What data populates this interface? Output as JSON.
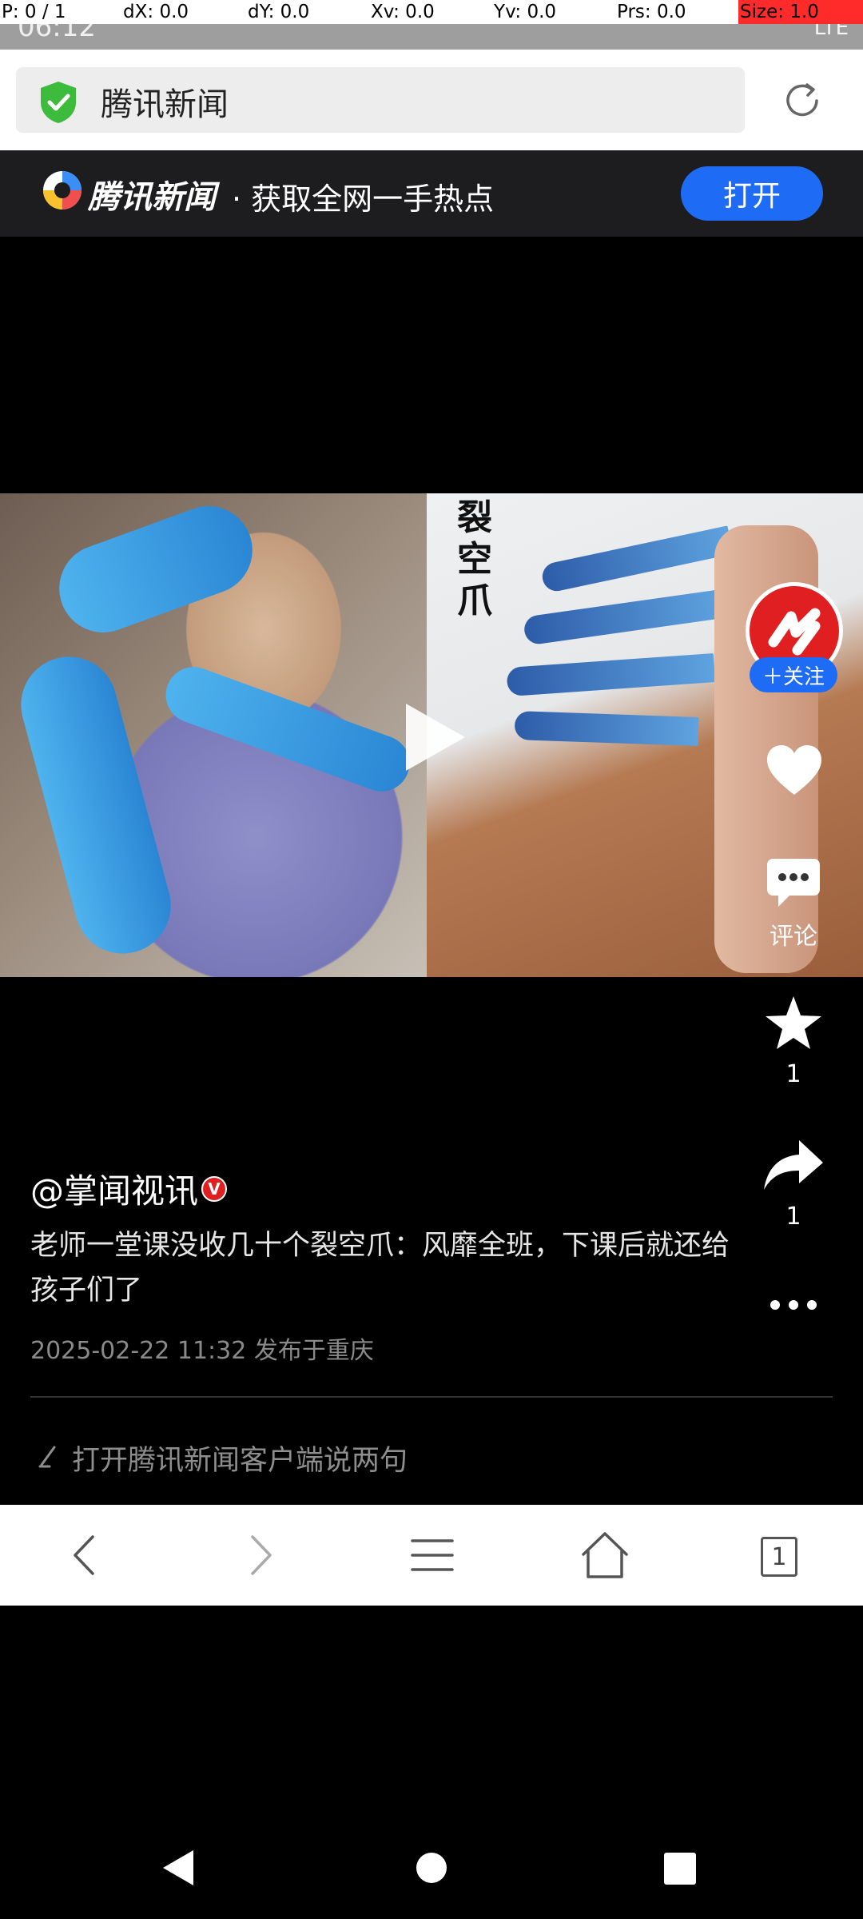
{
  "debug_bar": {
    "p": "P: 0 / 1",
    "dx": "dX: 0.0",
    "dy": "dY: 0.0",
    "xv": "Xv: 0.0",
    "yv": "Yv: 0.0",
    "prs": "Prs: 0.0",
    "size": "Size: 1.0"
  },
  "status_bar": {
    "time": "06:12",
    "network": "LTE"
  },
  "browser": {
    "url_title": "腾讯新闻",
    "shield_icon": "shield-check-icon",
    "reload_icon": "reload-icon"
  },
  "banner": {
    "brand": "腾讯新闻",
    "slogan": "· 获取全网一手热点",
    "open_label": "打开",
    "accent_color": "#1e6cf5"
  },
  "video": {
    "caption": "裂空爪",
    "play_icon": "play-icon"
  },
  "actions": {
    "follow_label": "关注",
    "comment_label": "评论",
    "favorite_count": "1",
    "share_count": "1"
  },
  "post": {
    "author": "@掌闻视讯",
    "badge": "V",
    "title": "老师一堂课没收几十个裂空爪：风靡全班，下课后就还给孩子们了",
    "meta": "2025-02-22 11:32  发布于重庆",
    "comment_prompt": "打开腾讯新闻客户端说两句"
  },
  "toolbar": {
    "tabs_count": "1"
  }
}
